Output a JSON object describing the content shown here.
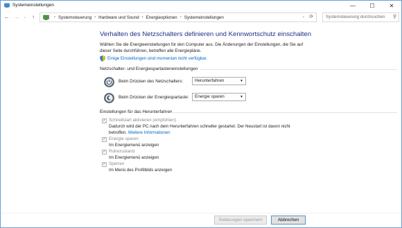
{
  "window": {
    "title": "Systemeinstellungen",
    "minimize": "—",
    "maximize": "☐",
    "close": "✕"
  },
  "nav": {
    "back": "←",
    "forward": "→",
    "recent": "⌄",
    "up": "↑",
    "breadcrumbs": [
      "Systemsteuerung",
      "Hardware und Sound",
      "Energieoptionen",
      "Systemeinstellungen"
    ],
    "breadcrumb_sep": "›",
    "search_placeholder": "Systemsteuerung durchsuchen"
  },
  "main": {
    "title": "Verhalten des Netzschalters definieren und Kennwortschutz einschalten",
    "description": "Wählen Sie die Energieeinstellungen für den Computer aus. Die Änderungen der Einstellungen, die Sie auf dieser Seite durchführen, betreffen alle Energiepläne.",
    "unavailable_link": "Einige Einstellungen sind momentan nicht verfügbar."
  },
  "power_section": {
    "heading": "Netzschalter- und Energiespartasteneinstellungen",
    "rows": [
      {
        "label": "Beim Drücken des Netzschalters:",
        "value": "Herunterfahren"
      },
      {
        "label": "Beim Drücken der Energiespartaste:",
        "value": "Energie sparen"
      }
    ]
  },
  "shutdown_section": {
    "heading": "Einstellungen für das Herunterfahren",
    "options": [
      {
        "label": "Schnellstart aktivieren (empfohlen)",
        "desc": "Dadurch wird der PC nach dem Herunterfahren schneller gestartet. Der Neustart ist davon nicht betroffen.",
        "link": "Weitere Informationen",
        "checked": true
      },
      {
        "label": "Energie sparen",
        "desc": "Im Energiemenü anzeigen",
        "checked": true
      },
      {
        "label": "Ruhezustand",
        "desc": "Im Energiemenü anzeigen",
        "checked": true
      },
      {
        "label": "Sperren",
        "desc": "Im Menü des Profilbilds anzeigen",
        "checked": true
      }
    ]
  },
  "buttons": {
    "save": "Änderungen speichern",
    "cancel": "Abbrechen"
  },
  "colors": {
    "title_blue": "#1e3287",
    "link_blue": "#0066cc",
    "disabled_gray": "#8a8a8a"
  }
}
